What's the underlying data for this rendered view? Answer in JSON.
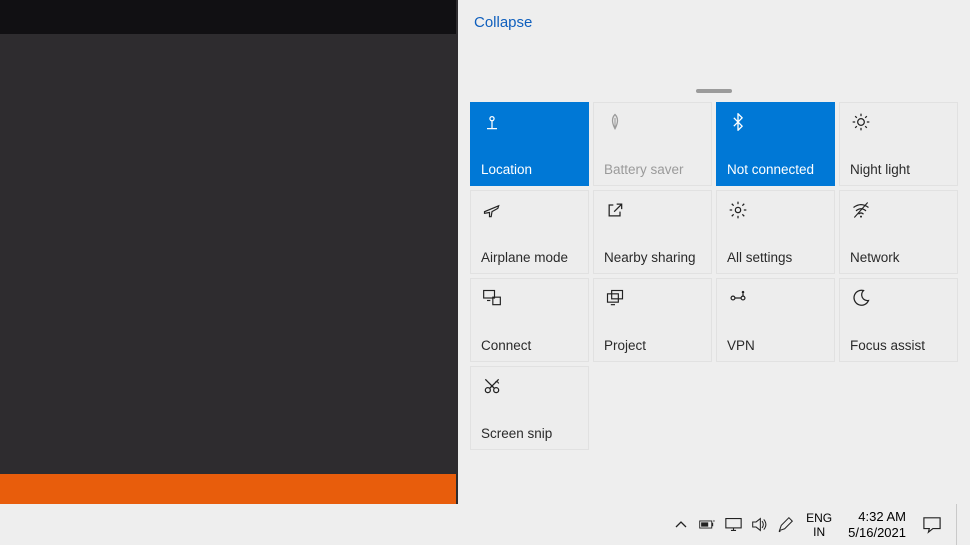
{
  "action_center": {
    "collapse_label": "Collapse",
    "tiles": [
      {
        "id": "location",
        "label": "Location",
        "active": true,
        "disabled": false,
        "icon": "location-icon"
      },
      {
        "id": "battery-saver",
        "label": "Battery saver",
        "active": false,
        "disabled": true,
        "icon": "leaf-icon"
      },
      {
        "id": "bluetooth",
        "label": "Not connected",
        "active": true,
        "disabled": false,
        "icon": "bluetooth-icon"
      },
      {
        "id": "night-light",
        "label": "Night light",
        "active": false,
        "disabled": false,
        "icon": "sun-icon"
      },
      {
        "id": "airplane-mode",
        "label": "Airplane mode",
        "active": false,
        "disabled": false,
        "icon": "airplane-icon"
      },
      {
        "id": "nearby-sharing",
        "label": "Nearby sharing",
        "active": false,
        "disabled": false,
        "icon": "share-icon"
      },
      {
        "id": "all-settings",
        "label": "All settings",
        "active": false,
        "disabled": false,
        "icon": "gear-icon"
      },
      {
        "id": "network",
        "label": "Network",
        "active": false,
        "disabled": false,
        "icon": "wifi-icon"
      },
      {
        "id": "connect",
        "label": "Connect",
        "active": false,
        "disabled": false,
        "icon": "connect-icon"
      },
      {
        "id": "project",
        "label": "Project",
        "active": false,
        "disabled": false,
        "icon": "project-icon"
      },
      {
        "id": "vpn",
        "label": "VPN",
        "active": false,
        "disabled": false,
        "icon": "vpn-icon"
      },
      {
        "id": "focus-assist",
        "label": "Focus assist",
        "active": false,
        "disabled": false,
        "icon": "moon-icon"
      },
      {
        "id": "screen-snip",
        "label": "Screen snip",
        "active": false,
        "disabled": false,
        "icon": "snip-icon"
      }
    ]
  },
  "taskbar": {
    "language_primary": "ENG",
    "language_secondary": "IN",
    "time": "4:32 AM",
    "date": "5/16/2021"
  }
}
